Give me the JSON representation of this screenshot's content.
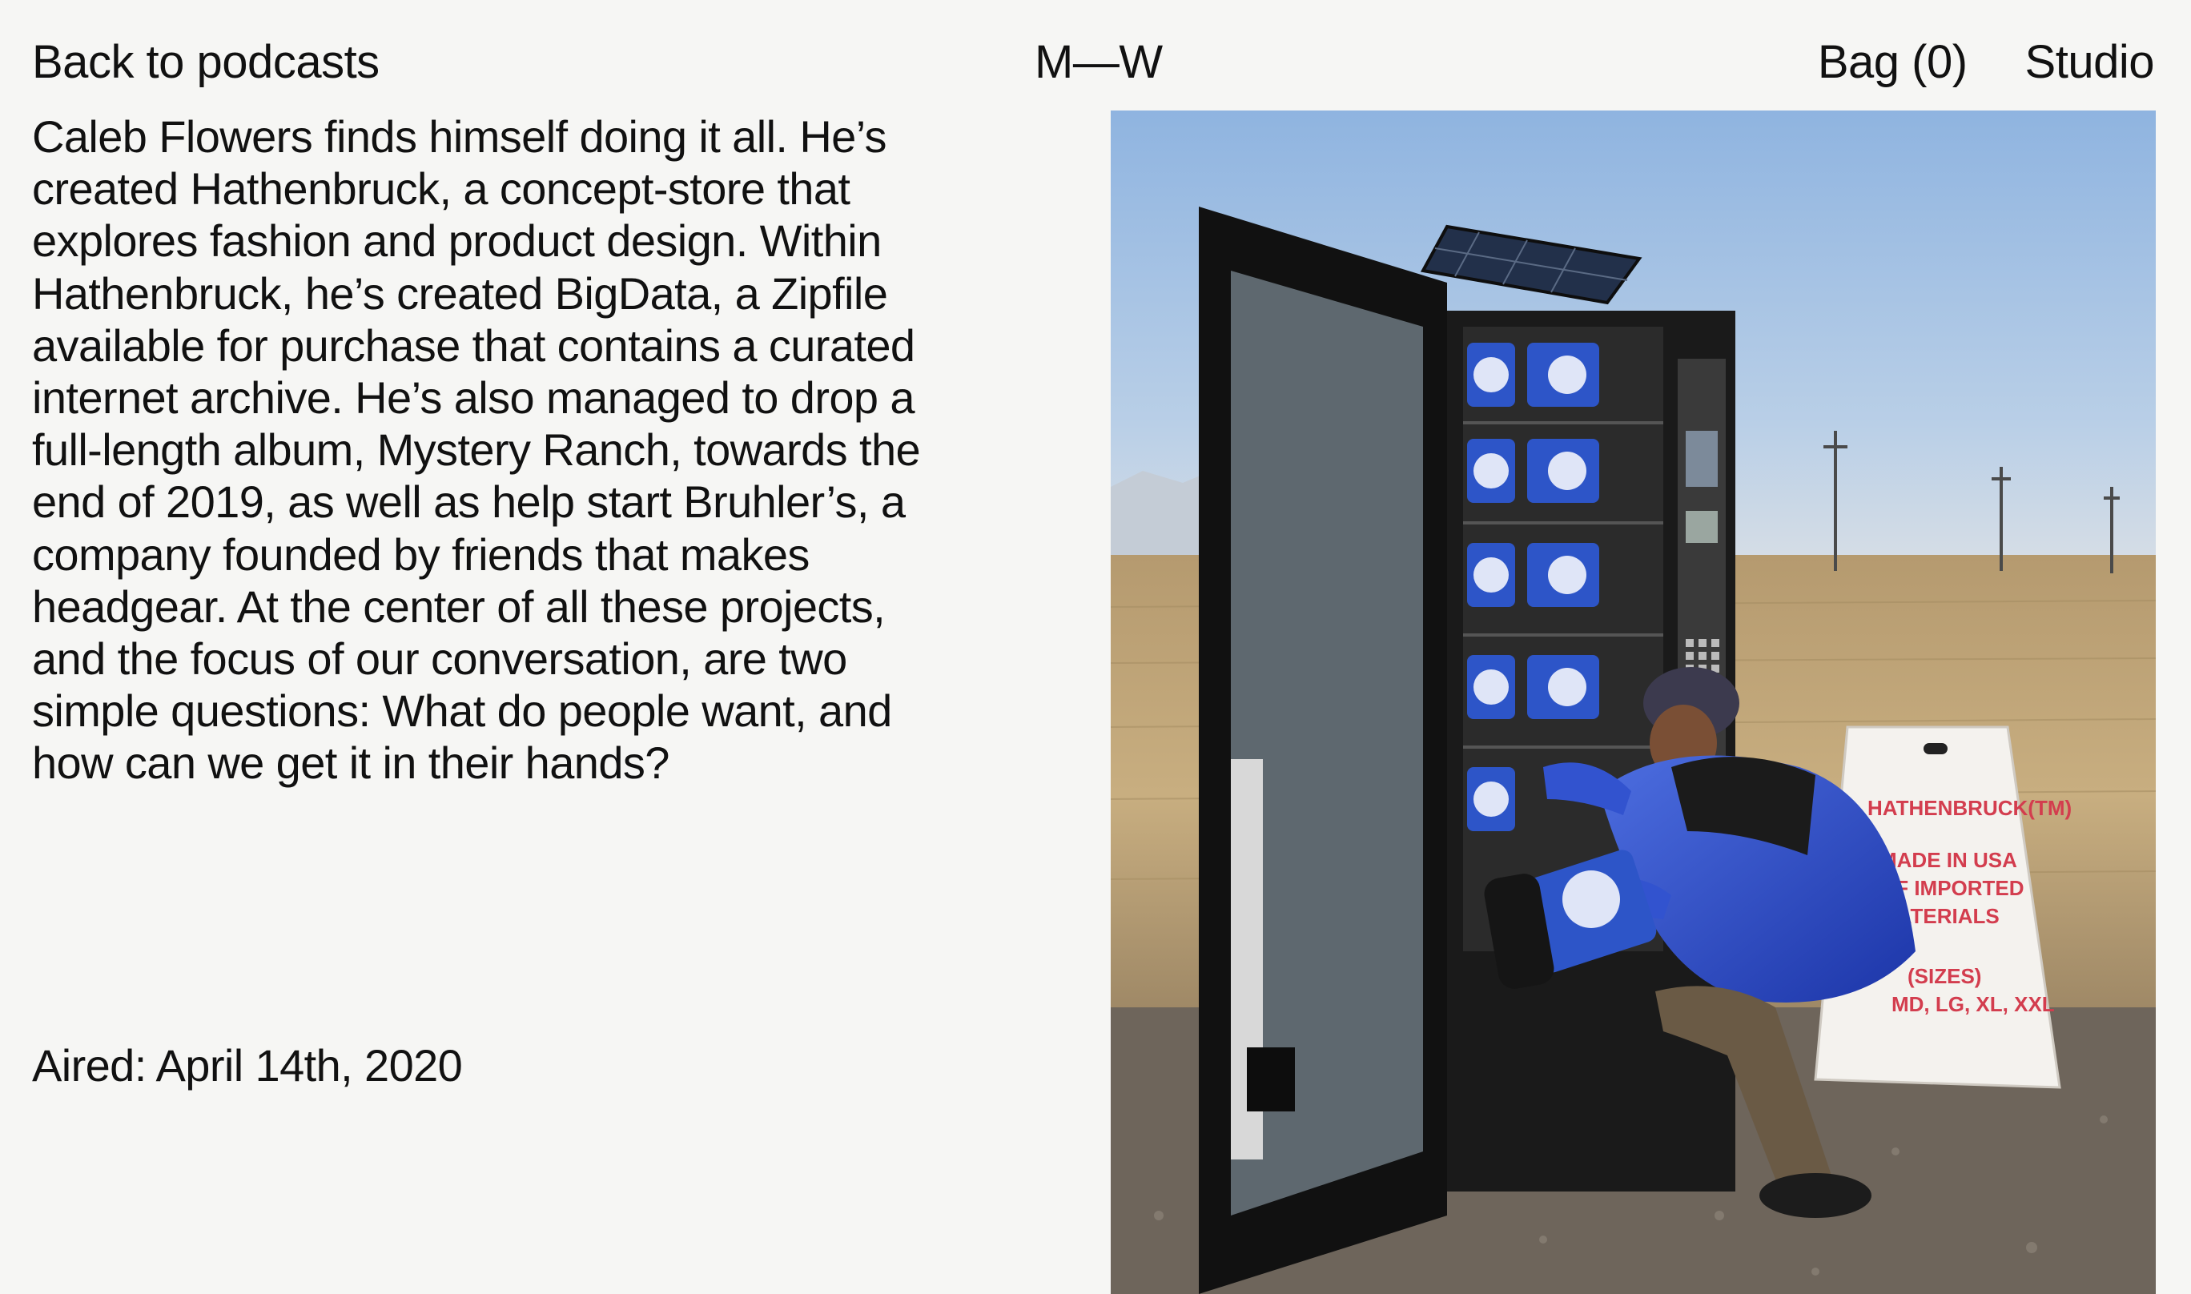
{
  "nav": {
    "back_label": "Back to podcasts",
    "logo": "M—W",
    "bag_label": "Bag (0)",
    "studio_label": "Studio"
  },
  "episode": {
    "description": "Caleb Flowers finds himself doing it all. He’s created Hathenbruck, a concept-store that explores fashion and product design. Within Hathenbruck, he’s created BigData, a Zipfile available for purchase that contains a curated internet archive. He’s also managed to drop a full-length album, Mystery Ranch, towards the end of 2019, as well as help start Bruhler’s, a company founded by friends that makes headgear. At the center of all these projects, and the focus of our conversation, are two simple questions: What do people want, and how can we get it in their hands?",
    "aired": "Aired: April 14th, 2020"
  },
  "photo": {
    "sign_lines": [
      "HATHENBRUCK(TM)",
      "MADE IN USA",
      "OF IMPORTED",
      "MATERIALS",
      "(SIZES)",
      "MD, LG, XL, XXL"
    ]
  },
  "colors": {
    "background": "#f6f6f4",
    "text": "#111111"
  }
}
